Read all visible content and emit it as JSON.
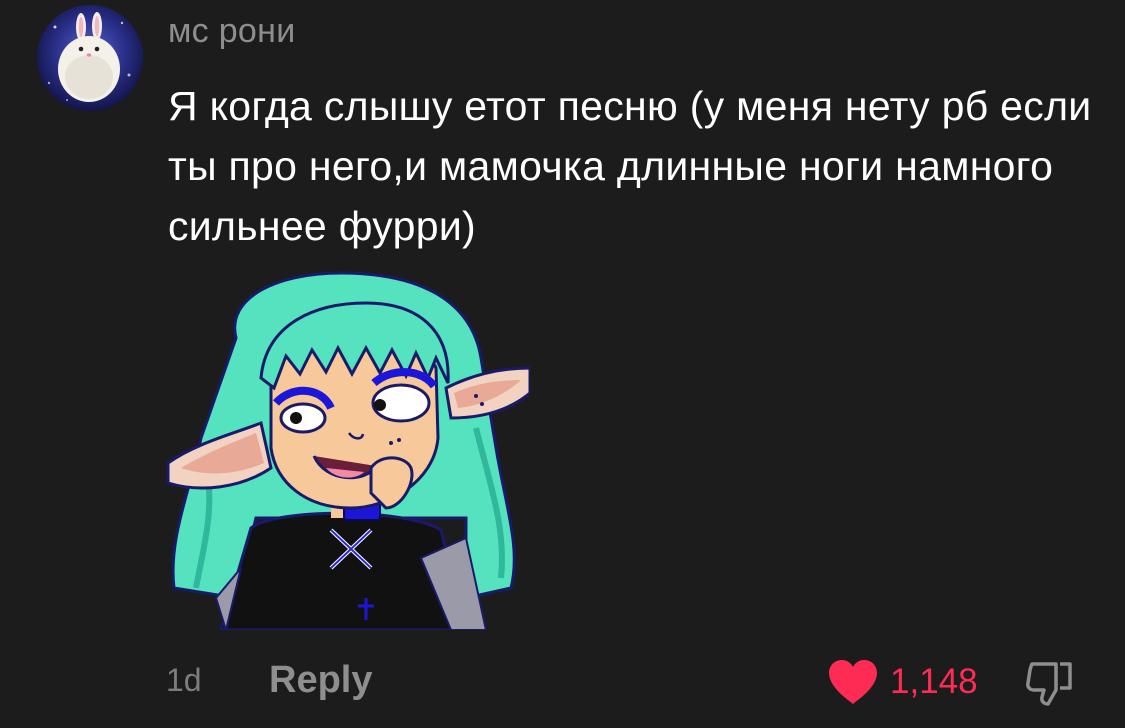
{
  "comment": {
    "username": "мс рони",
    "text": "Я когда слышу етот песню (у меня нету рб если ты про него,и мамочка длинные ноги намного сильнее фурри)",
    "time": "1d",
    "reply_label": "Reply",
    "likes": "1,148",
    "liked": true
  },
  "icons": {
    "like": "heart-icon",
    "dislike": "thumbs-down-icon",
    "avatar": "bunny-avatar"
  },
  "colors": {
    "background": "#1c1c1c",
    "username": "#8e8e8e",
    "text": "#ffffff",
    "like_active": "#fe2c55",
    "muted": "#7d7d7d"
  }
}
